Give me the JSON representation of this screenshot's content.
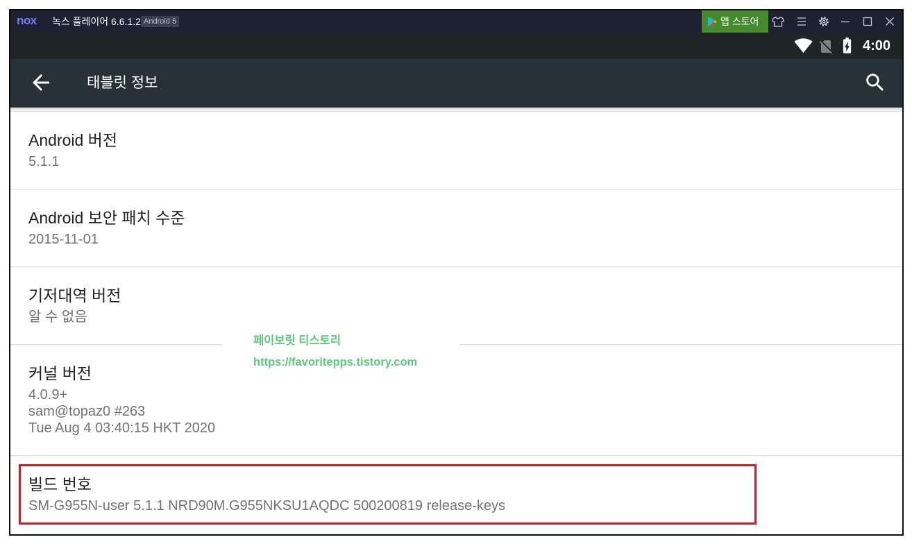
{
  "window": {
    "logo": "nox",
    "title": "녹스 플레이어 6.6.1.2",
    "android_badge": "Android 5",
    "app_store_label": "앱 스토어"
  },
  "status_bar": {
    "time": "4:00"
  },
  "action_bar": {
    "title": "태블릿 정보"
  },
  "items": [
    {
      "title": "Android 버전",
      "lines": [
        "5.1.1"
      ]
    },
    {
      "title": "Android 보안 패치 수준",
      "lines": [
        "2015-11-01"
      ]
    },
    {
      "title": "기저대역 버전",
      "lines": [
        "알 수 없음"
      ]
    },
    {
      "title": "커널 버전",
      "lines": [
        "4.0.9+",
        "sam@topaz0 #263",
        "Tue Aug 4 03:40:15 HKT 2020"
      ]
    },
    {
      "title": "빌드 번호",
      "lines": [
        "SM-G955N-user 5.1.1 NRD90M.G955NKSU1AQDC 500200819 release-keys"
      ]
    }
  ],
  "watermark": {
    "name": "페이보릿 티스토리",
    "url": "https://favoritepps.tistory.com"
  },
  "icons": {
    "play_store": "play-store-icon",
    "theme": "shirt-icon",
    "menu": "menu-icon",
    "settings": "gear-icon",
    "minimize": "minimize-icon",
    "maximize": "maximize-icon",
    "close": "close-icon",
    "wifi": "wifi-icon",
    "no_sim": "no-sim-icon",
    "battery": "battery-charging-icon",
    "back": "arrow-back-icon",
    "search": "search-icon"
  },
  "colors": {
    "title_bar": "#1d2131",
    "status_bar": "#1f2427",
    "action_bar": "#263238",
    "app_store": "#458b2d",
    "highlight": "#e3141f",
    "watermark": "#5cc97f",
    "text_primary": "#212121",
    "text_secondary": "#737373"
  }
}
